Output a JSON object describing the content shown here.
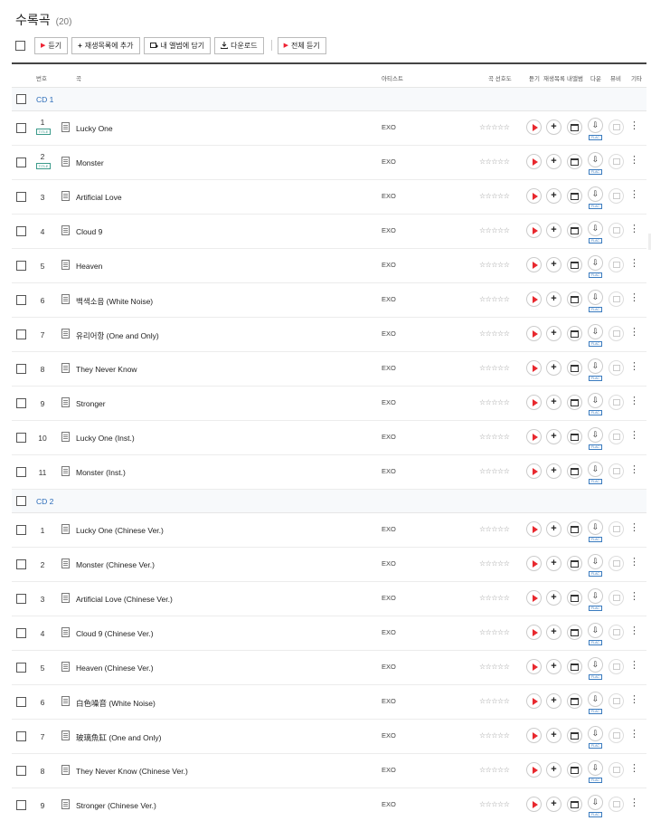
{
  "header": {
    "title": "수록곡",
    "count": "(20)"
  },
  "toolbar": {
    "listen_label": "듣기",
    "add_playlist_label": "재생목록에 추가",
    "add_album_label": "내 앨범에 담기",
    "download_label": "다운로드",
    "listen_all_label": "전체 듣기"
  },
  "columns": {
    "number": "번호",
    "song": "곡",
    "artist": "아티스트",
    "preference": "곡 선호도",
    "listen": "듣기",
    "playlist": "재생목록",
    "my_album": "내앨범",
    "download": "다운",
    "mv": "뮤비",
    "etc": "기타"
  },
  "rating_stars": "☆☆☆☆☆",
  "flac_badge": "FLAC",
  "title_badge": "TITLE",
  "more_icon": "⋮",
  "add_icon": "+",
  "accent_color": "#e8282e",
  "cd_label_color": "#2a6bb8",
  "discs": [
    {
      "label": "CD 1",
      "tracks": [
        {
          "number": "1",
          "title": "Lucky One",
          "artist": "EXO",
          "is_title": true
        },
        {
          "number": "2",
          "title": "Monster",
          "artist": "EXO",
          "is_title": true
        },
        {
          "number": "3",
          "title": "Artificial Love",
          "artist": "EXO",
          "is_title": false
        },
        {
          "number": "4",
          "title": "Cloud 9",
          "artist": "EXO",
          "is_title": false
        },
        {
          "number": "5",
          "title": "Heaven",
          "artist": "EXO",
          "is_title": false
        },
        {
          "number": "6",
          "title": "백색소음 (White Noise)",
          "artist": "EXO",
          "is_title": false
        },
        {
          "number": "7",
          "title": "유리어항 (One and Only)",
          "artist": "EXO",
          "is_title": false
        },
        {
          "number": "8",
          "title": "They Never Know",
          "artist": "EXO",
          "is_title": false
        },
        {
          "number": "9",
          "title": "Stronger",
          "artist": "EXO",
          "is_title": false
        },
        {
          "number": "10",
          "title": "Lucky One (Inst.)",
          "artist": "EXO",
          "is_title": false
        },
        {
          "number": "11",
          "title": "Monster (Inst.)",
          "artist": "EXO",
          "is_title": false
        }
      ]
    },
    {
      "label": "CD 2",
      "tracks": [
        {
          "number": "1",
          "title": "Lucky One (Chinese Ver.)",
          "artist": "EXO",
          "is_title": false
        },
        {
          "number": "2",
          "title": "Monster (Chinese Ver.)",
          "artist": "EXO",
          "is_title": false
        },
        {
          "number": "3",
          "title": "Artificial Love (Chinese Ver.)",
          "artist": "EXO",
          "is_title": false
        },
        {
          "number": "4",
          "title": "Cloud 9 (Chinese Ver.)",
          "artist": "EXO",
          "is_title": false
        },
        {
          "number": "5",
          "title": "Heaven (Chinese Ver.)",
          "artist": "EXO",
          "is_title": false
        },
        {
          "number": "6",
          "title": "白色噪音 (White Noise)",
          "artist": "EXO",
          "is_title": false
        },
        {
          "number": "7",
          "title": "玻璃魚缸 (One and Only)",
          "artist": "EXO",
          "is_title": false
        },
        {
          "number": "8",
          "title": "They Never Know (Chinese Ver.)",
          "artist": "EXO",
          "is_title": false
        },
        {
          "number": "9",
          "title": "Stronger (Chinese Ver.)",
          "artist": "EXO",
          "is_title": false
        }
      ]
    }
  ]
}
